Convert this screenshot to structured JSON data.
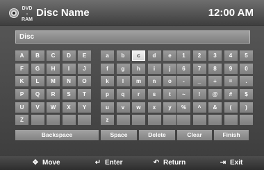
{
  "header": {
    "dvd_top": "DVD",
    "dvd_bottom": "-RAM",
    "title": "Disc Name",
    "time": "12:00 AM"
  },
  "name_field": {
    "value": "Disc"
  },
  "keyboard": {
    "selected_key": "c",
    "rows": [
      [
        "A",
        "B",
        "C",
        "D",
        "E",
        "a",
        "b",
        "c",
        "d",
        "e",
        "1",
        "2",
        "3",
        "4",
        "5"
      ],
      [
        "F",
        "G",
        "H",
        "I",
        "J",
        "f",
        "g",
        "h",
        "i",
        "j",
        "6",
        "7",
        "8",
        "9",
        "0"
      ],
      [
        "K",
        "L",
        "M",
        "N",
        "O",
        "k",
        "l",
        "m",
        "n",
        "o",
        "-",
        "_",
        "+",
        "=",
        "."
      ],
      [
        "P",
        "Q",
        "R",
        "S",
        "T",
        "p",
        "q",
        "r",
        "s",
        "t",
        "~",
        "!",
        "@",
        "#",
        "$"
      ],
      [
        "U",
        "V",
        "W",
        "X",
        "Y",
        "u",
        "v",
        "w",
        "x",
        "y",
        "%",
        "^",
        "&",
        "(",
        ")"
      ],
      [
        "Z",
        "",
        "",
        "",
        "",
        "z",
        "",
        "",
        "",
        "",
        "",
        "",
        "",
        "",
        ""
      ]
    ],
    "actions": {
      "backspace": "Backspace",
      "space": "Space",
      "delete": "Delete",
      "clear": "Clear",
      "finish": "Finish"
    }
  },
  "footer": {
    "move": "Move",
    "enter": "Enter",
    "return": "Return",
    "exit": "Exit"
  }
}
